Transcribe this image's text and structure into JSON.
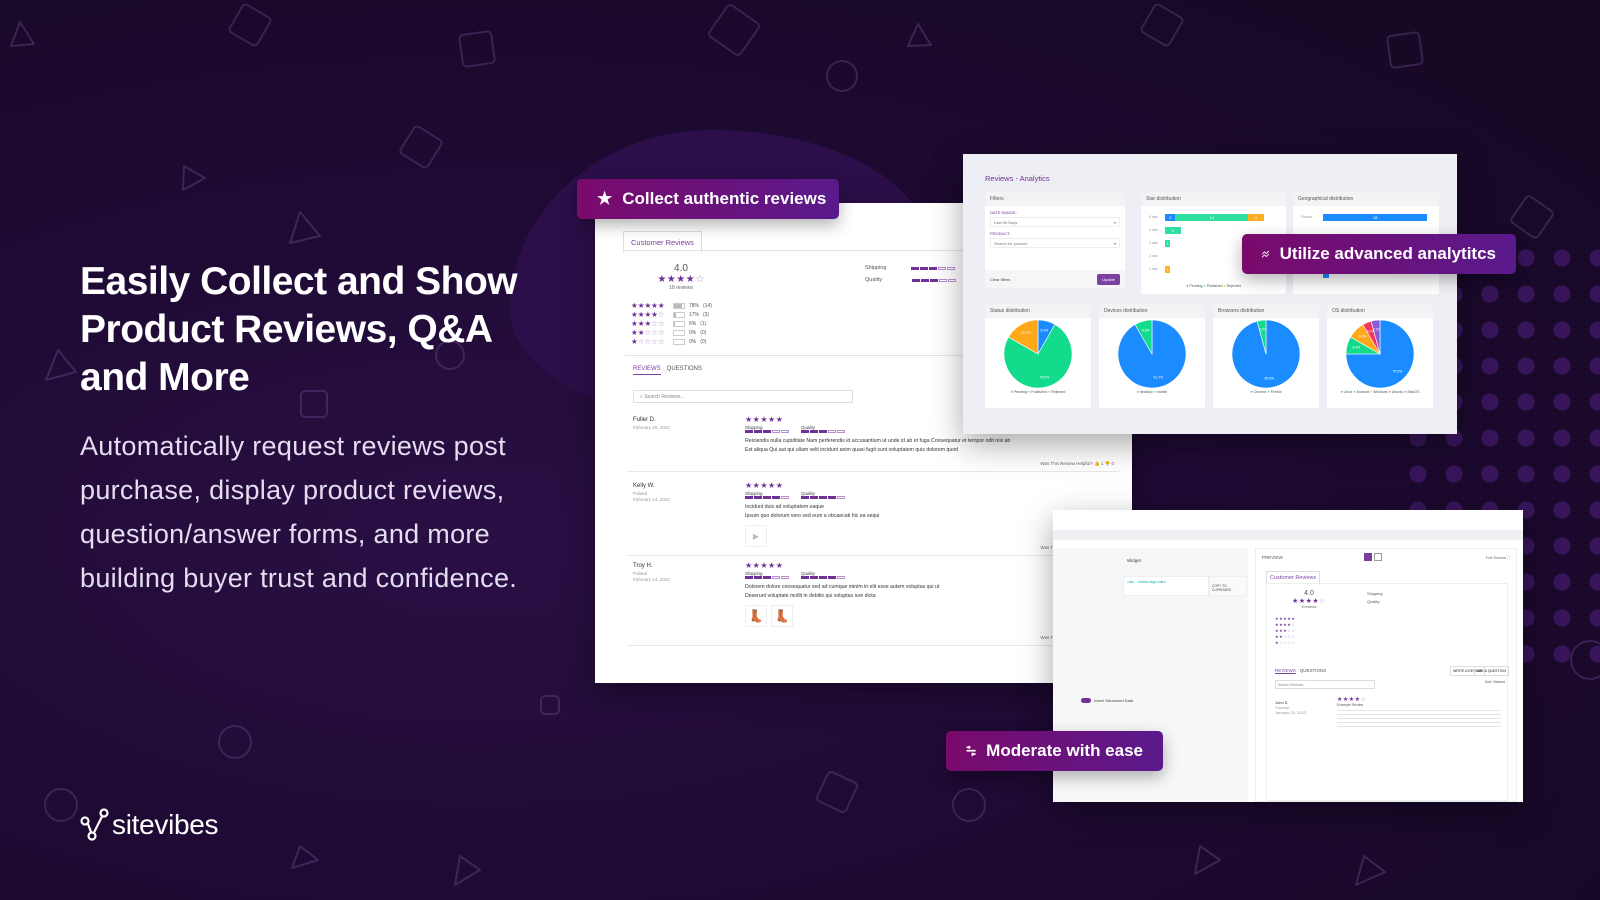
{
  "hero": {
    "headline": "Easily Collect and Show Product Reviews, Q&A and More",
    "subtext": "Automatically request reviews post purchase, display product reviews, question/answer forms, and more building buyer trust and confidence.",
    "brand": "sitevibes",
    "brand_icon": "network-nodes-icon"
  },
  "colors": {
    "brand_purple": "#6f3196",
    "pill_start": "#7a0a6b",
    "pill_end": "#5a1a8c",
    "background": "#1b0b2e"
  },
  "pills": [
    {
      "label": "Collect authentic reviews",
      "icon": "star-icon"
    },
    {
      "label": "Utilize advanced analytitcs",
      "icon": "trend-chart-icon"
    },
    {
      "label": "Moderate with ease",
      "icon": "sliders-icon"
    }
  ],
  "reviews_widget": {
    "tab": "Customer Reviews",
    "average": "4.0",
    "count_label": "18 reviews",
    "breakdown": [
      {
        "stars": 5,
        "percent": "78%",
        "count": "(14)",
        "fill": 0.78
      },
      {
        "stars": 4,
        "percent": "17%",
        "count": "(3)",
        "fill": 0.17
      },
      {
        "stars": 3,
        "percent": "6%",
        "count": "(1)",
        "fill": 0.06
      },
      {
        "stars": 2,
        "percent": "0%",
        "count": "(0)",
        "fill": 0
      },
      {
        "stars": 1,
        "percent": "0%",
        "count": "(0)",
        "fill": 0
      }
    ],
    "attributes": [
      {
        "label": "Shipping",
        "value": 3,
        "max": 5
      },
      {
        "label": "Quality",
        "value": 3,
        "max": 5
      }
    ],
    "tabs": [
      "REVIEWS",
      "QUESTIONS"
    ],
    "search_placeholder": "Search Reviews...",
    "helpful_label": "Was This Review Helpful?",
    "reviews": [
      {
        "name": "Fuller D.",
        "location": "",
        "date": "February 28, 2022",
        "rating": 5,
        "shipping": 3,
        "quality": 3,
        "lines": [
          "Reiciendis nulla cupiditate Nam perferendis id accusantium ut unde id ab et fuga Consequatur et tempor odit nisi ab",
          "Est aliqua Qui aut qui ullam velit incidunt anim quasi fugit sunt voluptatem quis dolorem quod"
        ],
        "up": "1",
        "down": "0",
        "media": "none"
      },
      {
        "name": "Kelly W.",
        "location": "Poland",
        "date": "February 14, 2022",
        "rating": 5,
        "shipping": 4,
        "quality": 4,
        "lines": [
          "Incidunt duis ad voluptatem eaque",
          "Ipsum quo dolorum vero sed eum a obcaecati hic ea sequi"
        ],
        "up": "0",
        "down": "0",
        "media": "video"
      },
      {
        "name": "Troy H.",
        "location": "Poland",
        "date": "February 14, 2022",
        "rating": 5,
        "shipping": 3,
        "quality": 4,
        "lines": [
          "Dolorem dolore consequatur sed ad cumque minim in elit esse autem voluptas qui ut",
          "Deserunt voluptate mollit in debitis qui voluptas iure dicta"
        ],
        "up": "0",
        "down": "0",
        "media": "boots",
        "reply_date": "February 14, 2022"
      }
    ]
  },
  "analytics": {
    "title": "Reviews - Analytics",
    "filters": {
      "title": "Filters",
      "date_label": "DATE RANGE:",
      "date_value": "Last 90 Days",
      "product_label": "PRODUCT:",
      "product_placeholder": "Search for product",
      "clear": "Clear filters",
      "update": "Update"
    },
    "star_distribution": {
      "title": "Star distribution",
      "rows": [
        {
          "label": "5 star",
          "pending": 2,
          "published": 14,
          "rejected": 3
        },
        {
          "label": "4 star",
          "pending": 0,
          "published": 3,
          "rejected": 0
        },
        {
          "label": "3 star",
          "pending": 0,
          "published": 1,
          "rejected": 0
        },
        {
          "label": "2 star",
          "pending": 0,
          "published": 0,
          "rejected": 0
        },
        {
          "label": "1 star",
          "pending": 0,
          "published": 0,
          "rejected": 1
        }
      ],
      "legend": [
        "Pending",
        "Published",
        "Rejected"
      ]
    },
    "geo_distribution": {
      "title": "Geographical distribution",
      "rows": [
        {
          "label": "Poland",
          "value": 18
        },
        {
          "label": "",
          "value": 1
        }
      ]
    },
    "pies": [
      {
        "title": "Status distribution",
        "slices": [
          {
            "label": "Pending",
            "value": 8.3,
            "color": "#1a8cff"
          },
          {
            "label": "Published",
            "value": 75.0,
            "color": "#12db8c"
          },
          {
            "label": "Rejected",
            "value": 16.7,
            "color": "#ffa91a"
          }
        ]
      },
      {
        "title": "Devices distribution",
        "slices": [
          {
            "label": "desktop",
            "value": 91.7,
            "color": "#1a8cff"
          },
          {
            "label": "mobile",
            "value": 8.3,
            "color": "#12db8c"
          }
        ]
      },
      {
        "title": "Browsers distribution",
        "slices": [
          {
            "label": "Chrome",
            "value": 95.8,
            "color": "#1a8cff"
          },
          {
            "label": "Firefox",
            "value": 4.2,
            "color": "#12db8c"
          }
        ]
      },
      {
        "title": "OS distribution",
        "slices": [
          {
            "label": "Linux",
            "value": 75.0,
            "color": "#1a8cff"
          },
          {
            "label": "Android",
            "value": 8.3,
            "color": "#12db8c"
          },
          {
            "label": "Windows",
            "value": 8.3,
            "color": "#ffa91a"
          },
          {
            "label": "Ubuntu",
            "value": 4.2,
            "color": "#f5365c"
          },
          {
            "label": "MacOS",
            "value": 4.2,
            "color": "#8a5bd6"
          }
        ]
      }
    ]
  },
  "moderation": {
    "widget_label": "Widget",
    "copy_button": "COPY TO CLIPBOARD",
    "toggle_label": "Insert Structured Data",
    "preview_label": "PREVIEW",
    "fullscreen": "Full Screen",
    "tab": "Customer Reviews",
    "average": "4.0",
    "count_label": "8 reviews",
    "tabs": [
      "REVIEWS",
      "QUESTIONS"
    ],
    "write_review": "WRITE A REVIEW",
    "ask_question": "ASK A QUESTION",
    "sort_label": "Sort: Newest",
    "search_placeholder": "Search Reviews...",
    "review": {
      "name": "John S.",
      "location": "Country",
      "date": "January 25, 2022",
      "title": "Example Review",
      "rating": 4
    }
  }
}
